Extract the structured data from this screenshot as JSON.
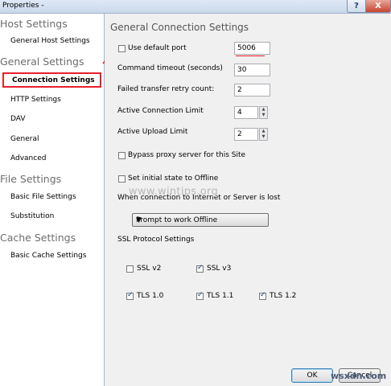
{
  "window": {
    "title": "Properties -",
    "help_glyph": "?",
    "close_glyph": "X"
  },
  "sidebar": {
    "groups": [
      {
        "label": "Host Settings",
        "items": [
          "General Host Settings"
        ]
      },
      {
        "label": "General Settings",
        "items": [
          "Connection Settings",
          "HTTP Settings",
          "DAV",
          "General",
          "Advanced"
        ]
      },
      {
        "label": "File Settings",
        "items": [
          "Basic File Settings",
          "Substitution"
        ]
      },
      {
        "label": "Cache Settings",
        "items": [
          "Basic Cache Settings"
        ]
      }
    ],
    "selected": "Connection Settings"
  },
  "main": {
    "heading": "General Connection Settings",
    "use_default_port": {
      "label": "Use default port",
      "checked": false
    },
    "port_value": "5006",
    "command_timeout": {
      "label": "Command timeout (seconds)",
      "value": "30"
    },
    "retry_count": {
      "label": "Failed transfer retry count:",
      "value": "2"
    },
    "active_connection_limit": {
      "label": "Active Connection Limit",
      "value": "4"
    },
    "active_upload_limit": {
      "label": "Active Upload Limit",
      "value": "2"
    },
    "bypass_proxy": {
      "label": "Bypass proxy server for this Site",
      "checked": false
    },
    "initial_offline": {
      "label": "Set initial state to Offline",
      "checked": false
    },
    "lost_connection_label": "When connection to Internet or Server is lost",
    "lost_connection_selected": "Prompt to work Offline",
    "ssl_heading": "SSL Protocol Settings",
    "ssl_options": [
      {
        "label": "SSL v2",
        "checked": false
      },
      {
        "label": "SSL v3",
        "checked": true
      },
      {
        "label": "TLS 1.0",
        "checked": true
      },
      {
        "label": "TLS 1.1",
        "checked": true
      },
      {
        "label": "TLS 1.2",
        "checked": true
      }
    ],
    "ok_label": "OK",
    "cancel_label": "Cancel"
  },
  "watermark": "www.wintips.org",
  "corner_watermark": "wsxdn.com",
  "colors": {
    "highlight": "#e8202a",
    "sidebar_category": "#6d6d6d",
    "panel_bg": "#f0f0f0"
  }
}
